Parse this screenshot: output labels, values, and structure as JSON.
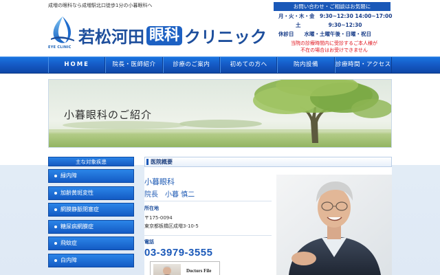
{
  "header": {
    "tagline": "成増の眼科なら成増駅北口徒歩1分の小暮眼科へ",
    "logo_sub": "EYE CLINIC",
    "logo_name_pre": "若松河田",
    "logo_name_box": "眼科",
    "logo_name_post": "クリニック"
  },
  "contact": {
    "head": "お問い合わせ・ご相談はお気軽に",
    "row1": "月・火・木・金　9:30~12:30  14:00~17:00",
    "row2": "土　　　　　 9:30~12:30",
    "row3": "休診日　　水曜・土曜午後・日曜・祝日",
    "note1": "当院の診療時間内に受診するご本人様が",
    "note2": "不在の場合はお受けできません"
  },
  "nav": {
    "items": [
      "HOME",
      "院長・医師紹介",
      "診療のご案内",
      "初めての方へ",
      "院内設備",
      "診療時間・アクセス"
    ]
  },
  "banner": {
    "title": "小暮眼科のご紹介"
  },
  "sidebar": {
    "head": "主な対象疾患",
    "items": [
      "緑内障",
      "加齢黄斑変性",
      "網膜静脈閉塞症",
      "糖尿病網膜症",
      "飛蚊症",
      "白内障"
    ]
  },
  "content": {
    "section_title": "医院概要",
    "clinic_name": "小暮眼科",
    "director": "院長　小暮 慎二",
    "address_label": "所在地",
    "postal": "〒175-0094",
    "address": "東京都板橋区成増3-10-5",
    "phone_label": "電話",
    "phone": "03-3979-3555",
    "doctors_file": "Doctors File"
  },
  "colors": {
    "brand_blue": "#1a58b8",
    "nav_blue": "#1559c4",
    "alert_red": "#e0101a"
  }
}
